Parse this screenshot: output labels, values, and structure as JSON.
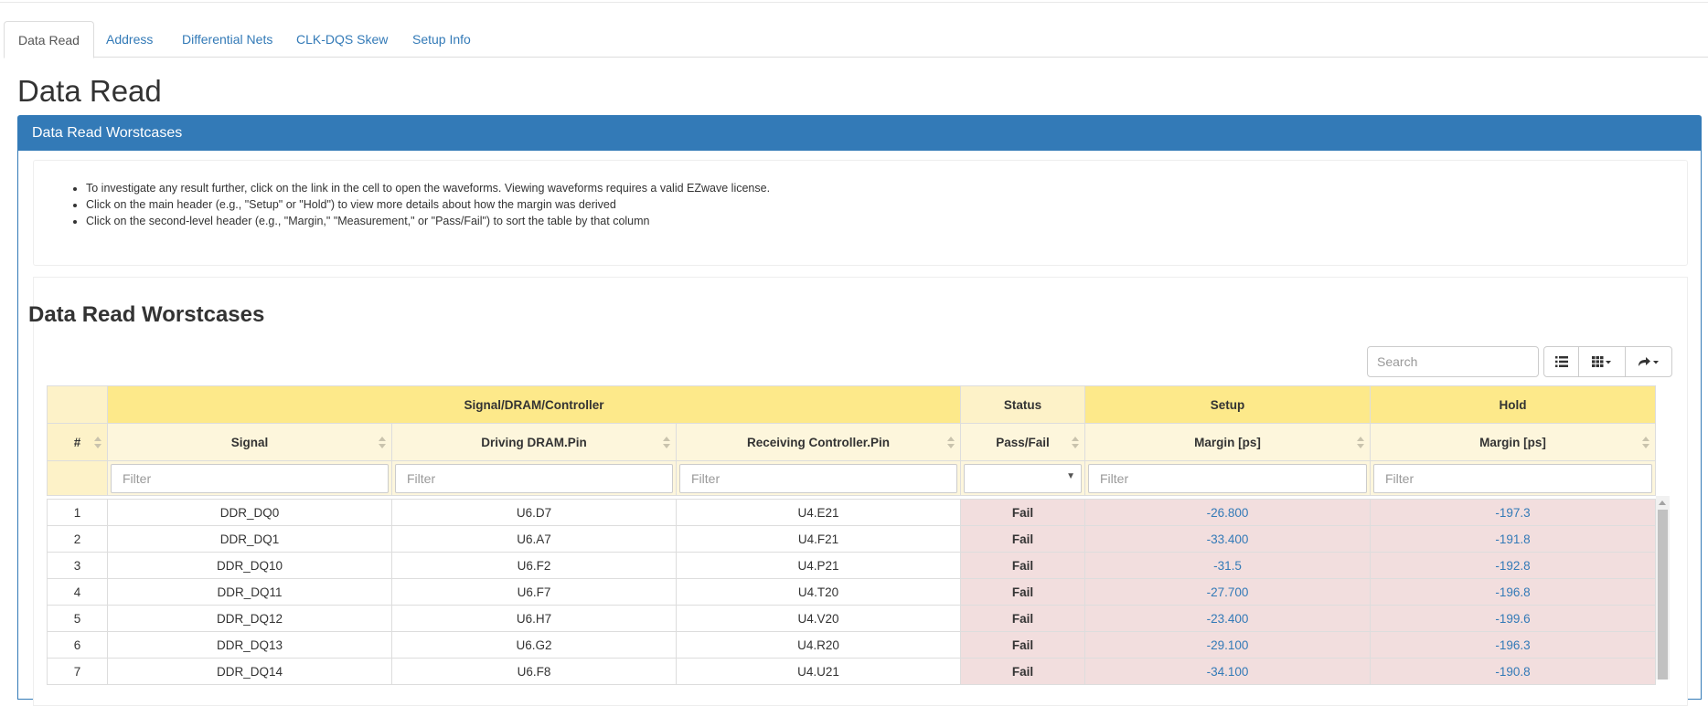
{
  "tabs": [
    {
      "label": "Data Read",
      "active": true
    },
    {
      "label": "Address",
      "active": false
    },
    {
      "label": "Differential Nets",
      "active": false
    },
    {
      "label": "CLK-DQS Skew",
      "active": false
    },
    {
      "label": "Setup Info",
      "active": false
    }
  ],
  "page_title": "Data Read",
  "panel": {
    "heading": "Data Read Worstcases",
    "notes": [
      "To investigate any result further, click on the link in the cell to open the waveforms. Viewing waveforms requires a valid EZwave license.",
      "Click on the main header (e.g., \"Setup\" or \"Hold\") to view more details about how the margin was derived",
      "Click on the second-level header (e.g., \"Margin,\" \"Measurement,\" or \"Pass/Fail\") to sort the table by that column"
    ],
    "sub_title": "Data Read Worstcases"
  },
  "toolbar": {
    "search_placeholder": "Search",
    "buttons": [
      "list-view-icon",
      "columns-icon",
      "export-icon"
    ]
  },
  "table": {
    "group_headers": {
      "signal_group": "Signal/DRAM/Controller",
      "status": "Status",
      "setup": "Setup",
      "hold": "Hold"
    },
    "columns": {
      "num": "#",
      "signal": "Signal",
      "driving": "Driving DRAM.Pin",
      "receiving": "Receiving Controller.Pin",
      "passfail": "Pass/Fail",
      "setup_margin": "Margin [ps]",
      "hold_margin": "Margin [ps]"
    },
    "filter_placeholder": "Filter",
    "rows": [
      {
        "num": "1",
        "signal": "DDR_DQ0",
        "driving": "U6.D7",
        "receiving": "U4.E21",
        "status": "Fail",
        "setup": "-26.800",
        "hold": "-197.3"
      },
      {
        "num": "2",
        "signal": "DDR_DQ1",
        "driving": "U6.A7",
        "receiving": "U4.F21",
        "status": "Fail",
        "setup": "-33.400",
        "hold": "-191.8"
      },
      {
        "num": "3",
        "signal": "DDR_DQ10",
        "driving": "U6.F2",
        "receiving": "U4.P21",
        "status": "Fail",
        "setup": "-31.5",
        "hold": "-192.8"
      },
      {
        "num": "4",
        "signal": "DDR_DQ11",
        "driving": "U6.F7",
        "receiving": "U4.T20",
        "status": "Fail",
        "setup": "-27.700",
        "hold": "-196.8"
      },
      {
        "num": "5",
        "signal": "DDR_DQ12",
        "driving": "U6.H7",
        "receiving": "U4.V20",
        "status": "Fail",
        "setup": "-23.400",
        "hold": "-199.6"
      },
      {
        "num": "6",
        "signal": "DDR_DQ13",
        "driving": "U6.G2",
        "receiving": "U4.R20",
        "status": "Fail",
        "setup": "-29.100",
        "hold": "-196.3"
      },
      {
        "num": "7",
        "signal": "DDR_DQ14",
        "driving": "U6.F8",
        "receiving": "U4.U21",
        "status": "Fail",
        "setup": "-34.100",
        "hold": "-190.8"
      }
    ]
  },
  "colors": {
    "primary": "#337ab7",
    "header_yellow": "#fde98a",
    "header_light": "#fdf6dc",
    "fail_bg": "#f2dede"
  }
}
